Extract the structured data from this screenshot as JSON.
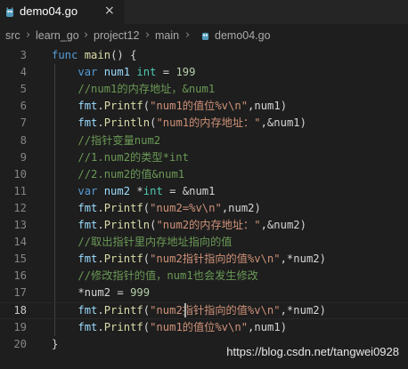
{
  "tab": {
    "title": "demo04.go",
    "close_glyph": "×",
    "icon": "go-file-icon"
  },
  "breadcrumb": {
    "items": [
      "src",
      "learn_go",
      "project12",
      "main",
      "demo04.go"
    ],
    "separator": "›"
  },
  "colors": {
    "keyword": "#569cd6",
    "function": "#dcdcaa",
    "string": "#ce9178",
    "number": "#b5cea8",
    "comment": "#6a9955",
    "variable": "#9cdcfe",
    "type": "#4ec9b0"
  },
  "editor": {
    "active_line": 18,
    "lines": [
      {
        "n": "3",
        "tokens": [
          [
            "kw",
            "func"
          ],
          [
            "pl",
            " "
          ],
          [
            "fn",
            "main"
          ],
          [
            "pl",
            "() {"
          ]
        ]
      },
      {
        "n": "4",
        "tokens": [
          [
            "pl",
            "    "
          ],
          [
            "kw",
            "var"
          ],
          [
            "pl",
            " "
          ],
          [
            "var",
            "num1"
          ],
          [
            "pl",
            " "
          ],
          [
            "ty",
            "int"
          ],
          [
            "pl",
            " = "
          ],
          [
            "num",
            "199"
          ]
        ]
      },
      {
        "n": "5",
        "tokens": [
          [
            "pl",
            "    "
          ],
          [
            "cm",
            "//num1的内存地址，&num1"
          ]
        ]
      },
      {
        "n": "6",
        "tokens": [
          [
            "pl",
            "    "
          ],
          [
            "var",
            "fmt"
          ],
          [
            "pl",
            "."
          ],
          [
            "fn",
            "Printf"
          ],
          [
            "pl",
            "("
          ],
          [
            "str",
            "\"num1的值位%v\\n\""
          ],
          [
            "pl",
            ",num1)"
          ]
        ]
      },
      {
        "n": "7",
        "tokens": [
          [
            "pl",
            "    "
          ],
          [
            "var",
            "fmt"
          ],
          [
            "pl",
            "."
          ],
          [
            "fn",
            "Println"
          ],
          [
            "pl",
            "("
          ],
          [
            "str",
            "\"num1的内存地址：\""
          ],
          [
            "pl",
            ",&num1)"
          ]
        ]
      },
      {
        "n": "8",
        "tokens": [
          [
            "pl",
            "    "
          ],
          [
            "cm",
            "//指针变量num2"
          ]
        ]
      },
      {
        "n": "9",
        "tokens": [
          [
            "pl",
            "    "
          ],
          [
            "cm",
            "//1.num2的类型*int"
          ]
        ]
      },
      {
        "n": "10",
        "tokens": [
          [
            "pl",
            "    "
          ],
          [
            "cm",
            "//2.num2的值&num1"
          ]
        ]
      },
      {
        "n": "11",
        "tokens": [
          [
            "pl",
            "    "
          ],
          [
            "kw",
            "var"
          ],
          [
            "pl",
            " "
          ],
          [
            "var",
            "num2"
          ],
          [
            "pl",
            " *"
          ],
          [
            "ty",
            "int"
          ],
          [
            "pl",
            " = &num1"
          ]
        ]
      },
      {
        "n": "12",
        "tokens": [
          [
            "pl",
            "    "
          ],
          [
            "var",
            "fmt"
          ],
          [
            "pl",
            "."
          ],
          [
            "fn",
            "Printf"
          ],
          [
            "pl",
            "("
          ],
          [
            "str",
            "\"num2=%v\\n\""
          ],
          [
            "pl",
            ",num2)"
          ]
        ]
      },
      {
        "n": "13",
        "tokens": [
          [
            "pl",
            "    "
          ],
          [
            "var",
            "fmt"
          ],
          [
            "pl",
            "."
          ],
          [
            "fn",
            "Println"
          ],
          [
            "pl",
            "("
          ],
          [
            "str",
            "\"num2的内存地址：\""
          ],
          [
            "pl",
            ",&num2)"
          ]
        ]
      },
      {
        "n": "14",
        "tokens": [
          [
            "pl",
            "    "
          ],
          [
            "cm",
            "//取出指针里内存地址指向的值"
          ]
        ]
      },
      {
        "n": "15",
        "tokens": [
          [
            "pl",
            "    "
          ],
          [
            "var",
            "fmt"
          ],
          [
            "pl",
            "."
          ],
          [
            "fn",
            "Printf"
          ],
          [
            "pl",
            "("
          ],
          [
            "str",
            "\"num2指针指向的值%v\\n\""
          ],
          [
            "pl",
            ",*num2)"
          ]
        ]
      },
      {
        "n": "16",
        "tokens": [
          [
            "pl",
            "    "
          ],
          [
            "cm",
            "//修改指针的值，num1也会发生修改"
          ]
        ]
      },
      {
        "n": "17",
        "tokens": [
          [
            "pl",
            "    *num2 = "
          ],
          [
            "num",
            "999"
          ]
        ]
      },
      {
        "n": "18",
        "tokens": [
          [
            "pl",
            "    "
          ],
          [
            "var",
            "fmt"
          ],
          [
            "pl",
            "."
          ],
          [
            "fn",
            "Printf"
          ],
          [
            "pl",
            "("
          ],
          [
            "str",
            "\"num2指针指向的值%v\\n\""
          ],
          [
            "pl",
            ",*num2)"
          ]
        ]
      },
      {
        "n": "19",
        "tokens": [
          [
            "pl",
            "    "
          ],
          [
            "var",
            "fmt"
          ],
          [
            "pl",
            "."
          ],
          [
            "fn",
            "Printf"
          ],
          [
            "pl",
            "("
          ],
          [
            "str",
            "\"num1的值位%v\\n\""
          ],
          [
            "pl",
            ",num1)"
          ]
        ]
      },
      {
        "n": "20",
        "tokens": [
          [
            "pl",
            "}"
          ]
        ]
      }
    ]
  },
  "watermark": "https://blog.csdn.net/tangwei0928"
}
